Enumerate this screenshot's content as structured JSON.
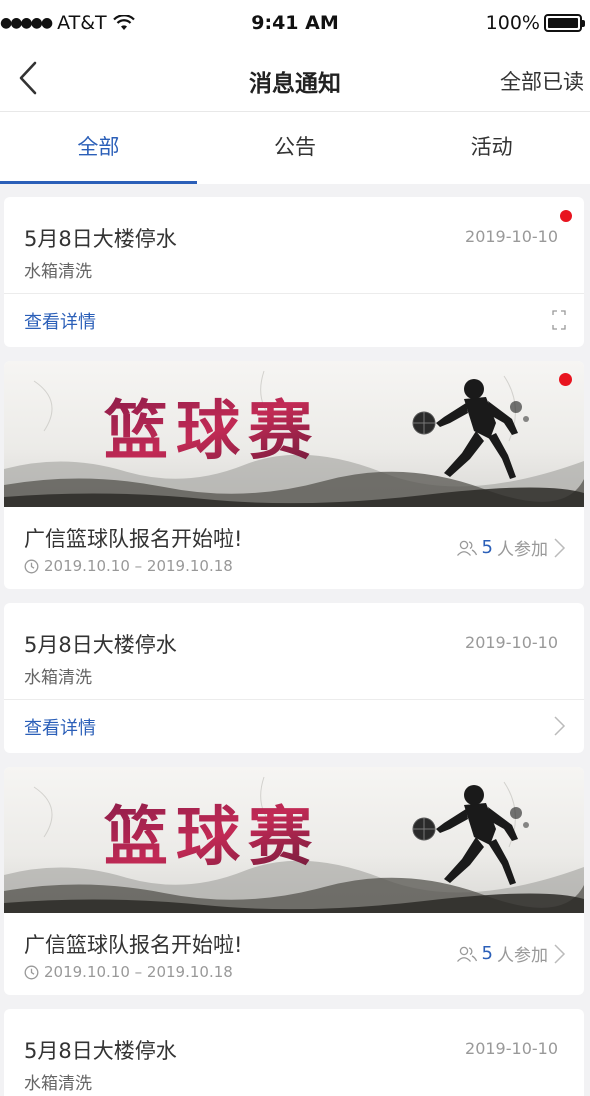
{
  "status_bar": {
    "carrier": "AT&T",
    "time": "9:41 AM",
    "battery": "100%"
  },
  "nav": {
    "title": "消息通知",
    "mark_all_read": "全部已读"
  },
  "tabs": [
    {
      "label": "全部",
      "active": true
    },
    {
      "label": "公告",
      "active": false
    },
    {
      "label": "活动",
      "active": false
    }
  ],
  "banner_text": "篮球赛",
  "cards": {
    "notice1": {
      "title": "5月8日大楼停水",
      "subtitle": "水箱清洗",
      "date": "2019-10-10",
      "detail": "查看详情"
    },
    "event1": {
      "title": "广信篮球队报名开始啦!",
      "date_range": "2019.10.10 – 2019.10.18",
      "count": "5",
      "join_label": "人参加"
    },
    "notice2": {
      "title": "5月8日大楼停水",
      "subtitle": "水箱清洗",
      "date": "2019-10-10",
      "detail": "查看详情"
    },
    "event2": {
      "title": "广信篮球队报名开始啦!",
      "date_range": "2019.10.10 – 2019.10.18",
      "count": "5",
      "join_label": "人参加"
    },
    "notice3": {
      "title": "5月8日大楼停水",
      "subtitle": "水箱清洗",
      "date": "2019-10-10"
    }
  },
  "colors": {
    "accent": "#2b5fb8",
    "unread": "#e8141f",
    "background": "#f2f2f4"
  }
}
